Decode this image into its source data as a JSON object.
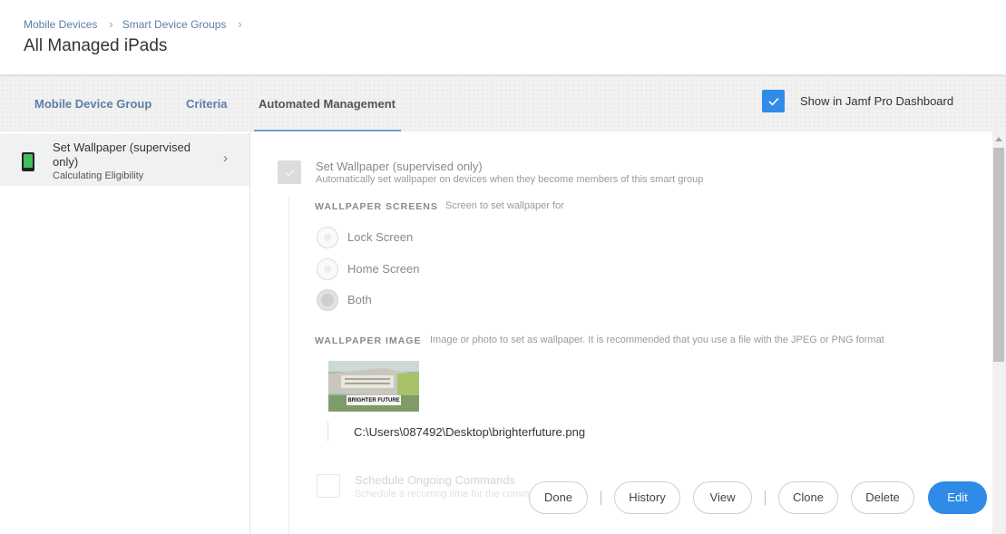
{
  "breadcrumb": [
    "Mobile Devices",
    "Smart Device Groups"
  ],
  "page_title": "All Managed iPads",
  "tabs": [
    {
      "label": "Mobile Device Group",
      "active": false
    },
    {
      "label": "Criteria",
      "active": false
    },
    {
      "label": "Automated Management",
      "active": true
    }
  ],
  "dashboard": {
    "label": "Show in Jamf Pro Dashboard",
    "checked": true
  },
  "left_panel": {
    "item": {
      "title": "Set Wallpaper (supervised only)",
      "subtitle": "Calculating Eligibility",
      "icon": "ipad-icon"
    }
  },
  "wallpaper": {
    "title": "Set Wallpaper (supervised only)",
    "description": "Automatically set wallpaper on devices when they become members of this smart group",
    "screens_label": "WALLPAPER SCREENS",
    "screens_hint": "Screen to set wallpaper for",
    "options": [
      "Lock Screen",
      "Home Screen",
      "Both"
    ],
    "selected": "Both",
    "image_label": "WALLPAPER IMAGE",
    "image_hint": "Image or photo to set as wallpaper. It is recommended that you use a file with the JPEG or PNG format",
    "thumb_text": "BRIGHTER FUTURE",
    "file_path": "C:\\Users\\087492\\Desktop\\brighterfuture.png"
  },
  "schedule": {
    "title": "Schedule Ongoing Commands",
    "description": "Schedule a recurring time for the commands"
  },
  "footer": {
    "done": "Done",
    "history": "History",
    "view": "View",
    "clone": "Clone",
    "delete": "Delete",
    "edit": "Edit"
  },
  "colors": {
    "accent": "#2f8be7",
    "link": "#5b7fa8"
  }
}
